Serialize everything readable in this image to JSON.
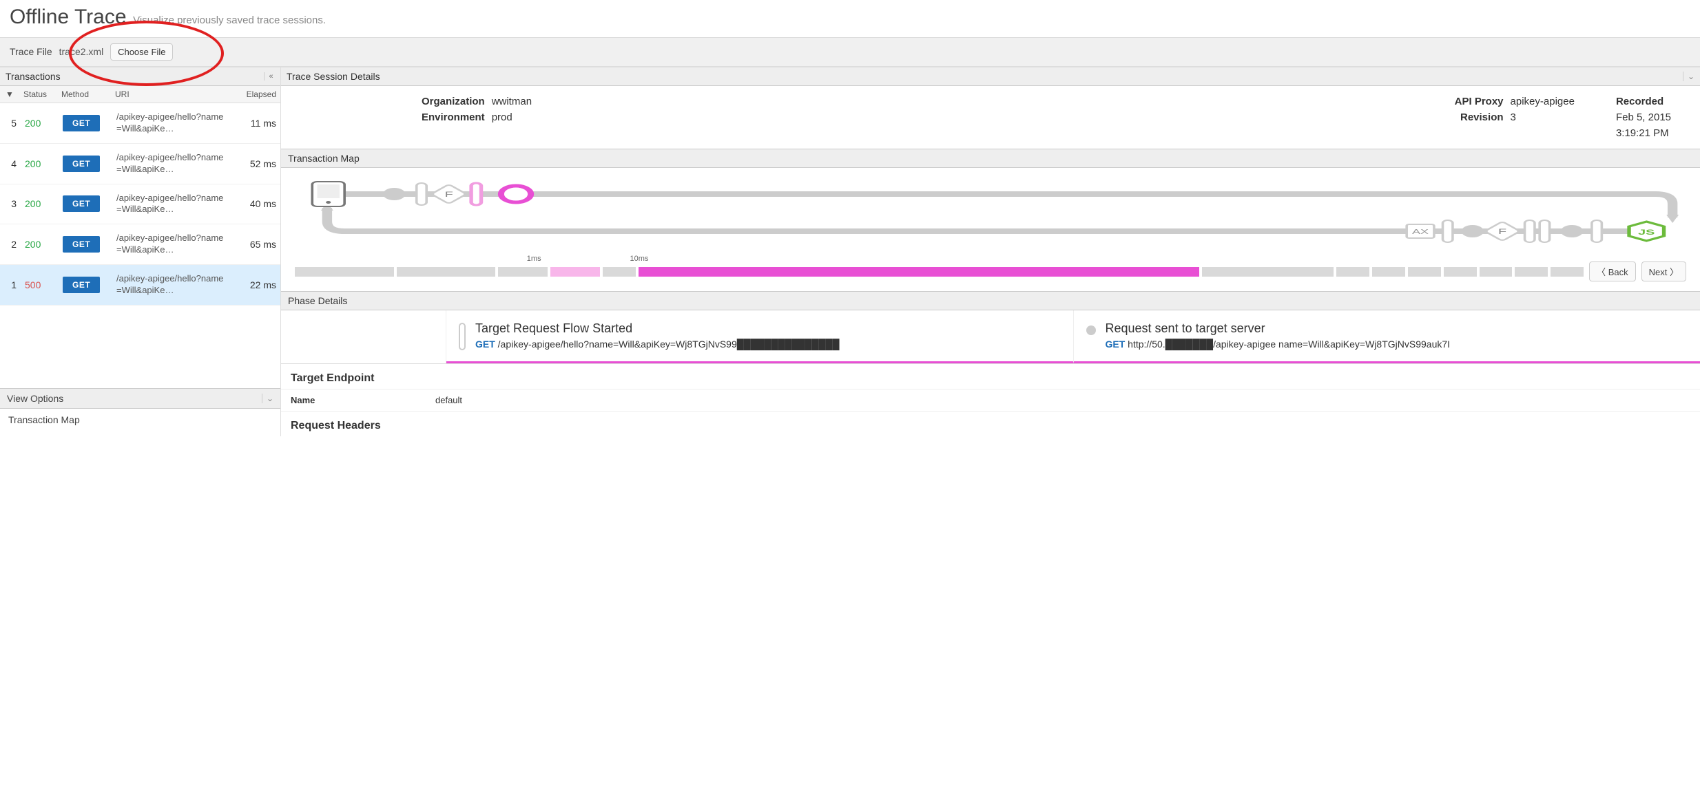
{
  "header": {
    "title": "Offline Trace",
    "subtitle": "Visualize previously saved trace sessions."
  },
  "traceFile": {
    "label": "Trace File",
    "filename": "trace2.xml",
    "choose_label": "Choose File"
  },
  "transactionsPanel": {
    "title": "Transactions",
    "collapse_glyph": "«",
    "columns": {
      "status": "Status",
      "method": "Method",
      "uri": "URI",
      "elapsed": "Elapsed"
    }
  },
  "transactions": [
    {
      "idx": "5",
      "status": "200",
      "status_class": "status-200",
      "method": "GET",
      "uri": "/apikey-apigee/hello?name=Will&apiKe…",
      "elapsed": "11 ms",
      "selected": false
    },
    {
      "idx": "4",
      "status": "200",
      "status_class": "status-200",
      "method": "GET",
      "uri": "/apikey-apigee/hello?name=Will&apiKe…",
      "elapsed": "52 ms",
      "selected": false
    },
    {
      "idx": "3",
      "status": "200",
      "status_class": "status-200",
      "method": "GET",
      "uri": "/apikey-apigee/hello?name=Will&apiKe…",
      "elapsed": "40 ms",
      "selected": false
    },
    {
      "idx": "2",
      "status": "200",
      "status_class": "status-200",
      "method": "GET",
      "uri": "/apikey-apigee/hello?name=Will&apiKe…",
      "elapsed": "65 ms",
      "selected": false
    },
    {
      "idx": "1",
      "status": "500",
      "status_class": "status-500",
      "method": "GET",
      "uri": "/apikey-apigee/hello?name=Will&apiKe…",
      "elapsed": "22 ms",
      "selected": true
    }
  ],
  "viewOptions": {
    "title": "View Options",
    "item1": "Transaction Map"
  },
  "details": {
    "panel_title": "Trace Session Details",
    "org_label": "Organization",
    "org_value": "wwitman",
    "env_label": "Environment",
    "env_value": "prod",
    "proxy_label": "API Proxy",
    "proxy_value": "apikey-apigee",
    "rev_label": "Revision",
    "rev_value": "3",
    "recorded_label": "Recorded",
    "recorded_date": "Feb 5, 2015",
    "recorded_time": "3:19:21 PM"
  },
  "map": {
    "section_title": "Transaction Map",
    "tick1": "1ms",
    "tick2": "10ms",
    "back_label": "Back",
    "next_label": "Next"
  },
  "phase": {
    "section_title": "Phase Details",
    "mid_title": "Target Request Flow Started",
    "mid_verb": "GET",
    "mid_path": "/apikey-apigee/hello?name=Will&apiKey=Wj8TGjNvS99███████████████",
    "right_title": "Request sent to target server",
    "right_verb": "GET",
    "right_path": "http://50.███████/apikey-apigee name=Will&apiKey=Wj8TGjNvS99auk7I"
  },
  "targetEndpoint": {
    "section": "Target Endpoint",
    "name_key": "Name",
    "name_val": "default"
  },
  "requestHeaders": {
    "section": "Request Headers"
  }
}
